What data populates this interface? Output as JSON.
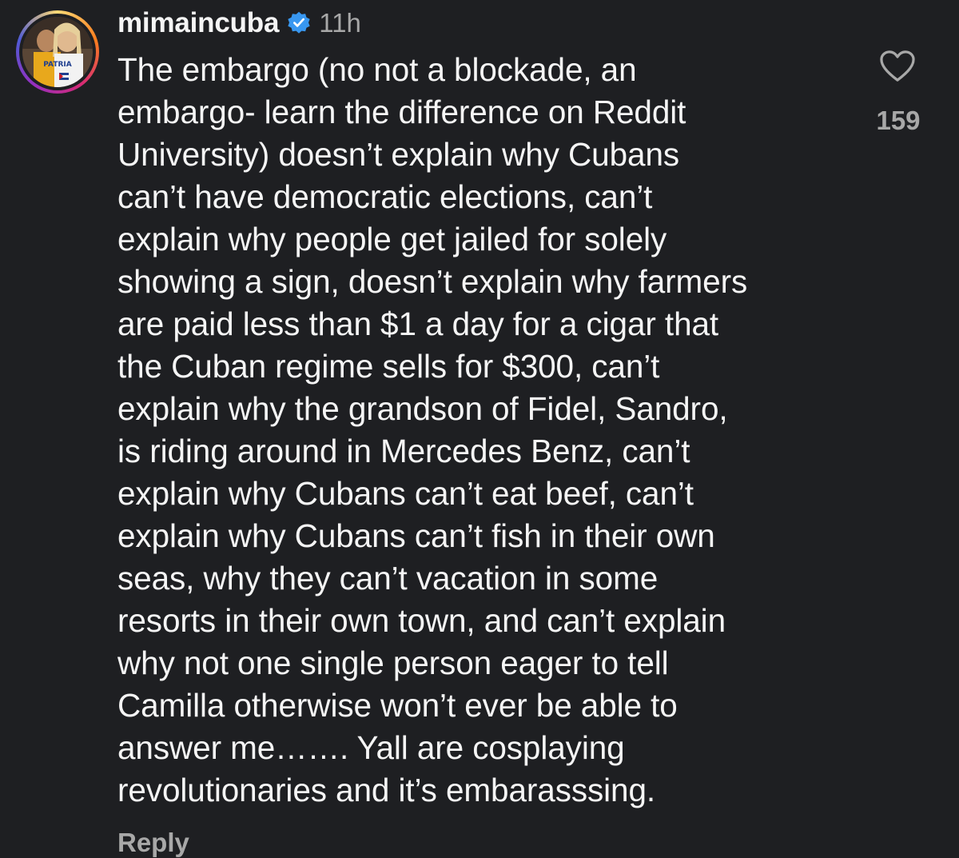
{
  "comment": {
    "username": "mimaincuba",
    "verified_icon": "verified-badge-icon",
    "time": "11h",
    "avatar_text": "PATRIA",
    "text": "The embargo (no not a blockade, an\nembargo- learn the difference on Reddit\nUniversity) doesn’t explain why Cubans\ncan’t have democratic elections, can’t\nexplain why people get jailed for solely\nshowing a sign, doesn’t explain why farmers\nare paid less than $1 a day for a cigar that\nthe Cuban regime sells for $300, can’t\nexplain why the grandson of Fidel, Sandro,\nis riding around in Mercedes Benz, can’t\nexplain why Cubans can’t eat beef, can’t\nexplain why Cubans can’t fish in their own\nseas, why they can’t vacation in some\nresorts in their own town, and can’t explain\nwhy not one single person eager to tell\nCamilla otherwise won’t ever be able to\nanswer me……. Yall are cosplaying\nrevolutionaries and it’s embarasssing.",
    "like_icon": "heart-outline-icon",
    "like_count": "159",
    "reply_label": "Reply"
  },
  "colors": {
    "background": "#1e1f22",
    "text_primary": "#f5f5f5",
    "text_secondary": "#a8a8a8",
    "verified_blue": "#3897f0"
  }
}
